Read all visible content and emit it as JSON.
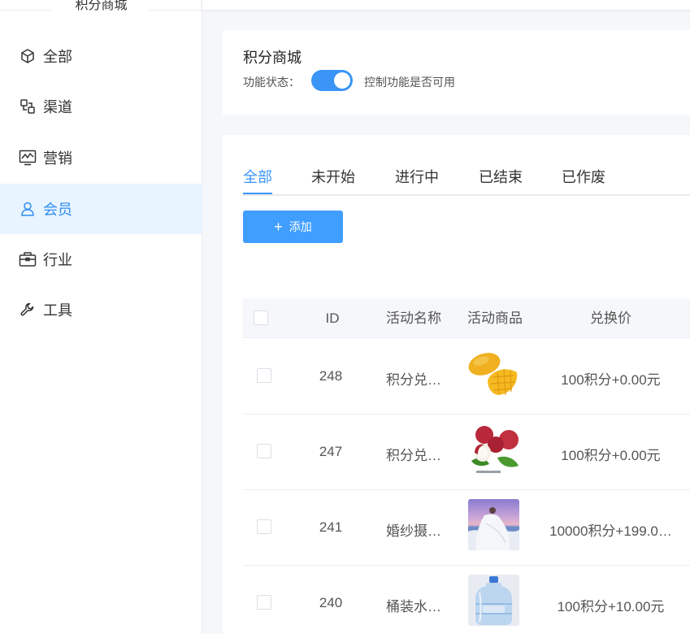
{
  "sidebar": {
    "title": "积分商城",
    "items": [
      {
        "label": "全部",
        "icon": "cube-icon",
        "active": false
      },
      {
        "label": "渠道",
        "icon": "channel-icon",
        "active": false
      },
      {
        "label": "营销",
        "icon": "chart-icon",
        "active": false
      },
      {
        "label": "会员",
        "icon": "user-icon",
        "active": true
      },
      {
        "label": "行业",
        "icon": "briefcase-icon",
        "active": false
      },
      {
        "label": "工具",
        "icon": "wrench-icon",
        "active": false
      }
    ]
  },
  "header": {
    "title": "积分商城",
    "status_label": "功能状态：",
    "status_on": true,
    "status_desc": "控制功能是否可用"
  },
  "tabs": [
    {
      "label": "全部",
      "active": true
    },
    {
      "label": "未开始",
      "active": false
    },
    {
      "label": "进行中",
      "active": false
    },
    {
      "label": "已结束",
      "active": false
    },
    {
      "label": "已作废",
      "active": false
    }
  ],
  "add_button": {
    "label": "添加"
  },
  "table": {
    "columns": [
      "ID",
      "活动名称",
      "活动商品",
      "兑换价"
    ],
    "rows": [
      {
        "id": "248",
        "name": "积分兑…",
        "image": "mango",
        "price": "100积分+0.00元"
      },
      {
        "id": "247",
        "name": "积分兑…",
        "image": "lychee",
        "price": "100积分+0.00元"
      },
      {
        "id": "241",
        "name": "婚纱摄…",
        "image": "wedding-photo",
        "price": "10000积分+199.0…"
      },
      {
        "id": "240",
        "name": "桶装水…",
        "image": "water-bottle",
        "price": "100积分+10.00元"
      }
    ]
  },
  "colors": {
    "accent": "#409eff",
    "active_bg": "#e8f4ff"
  }
}
